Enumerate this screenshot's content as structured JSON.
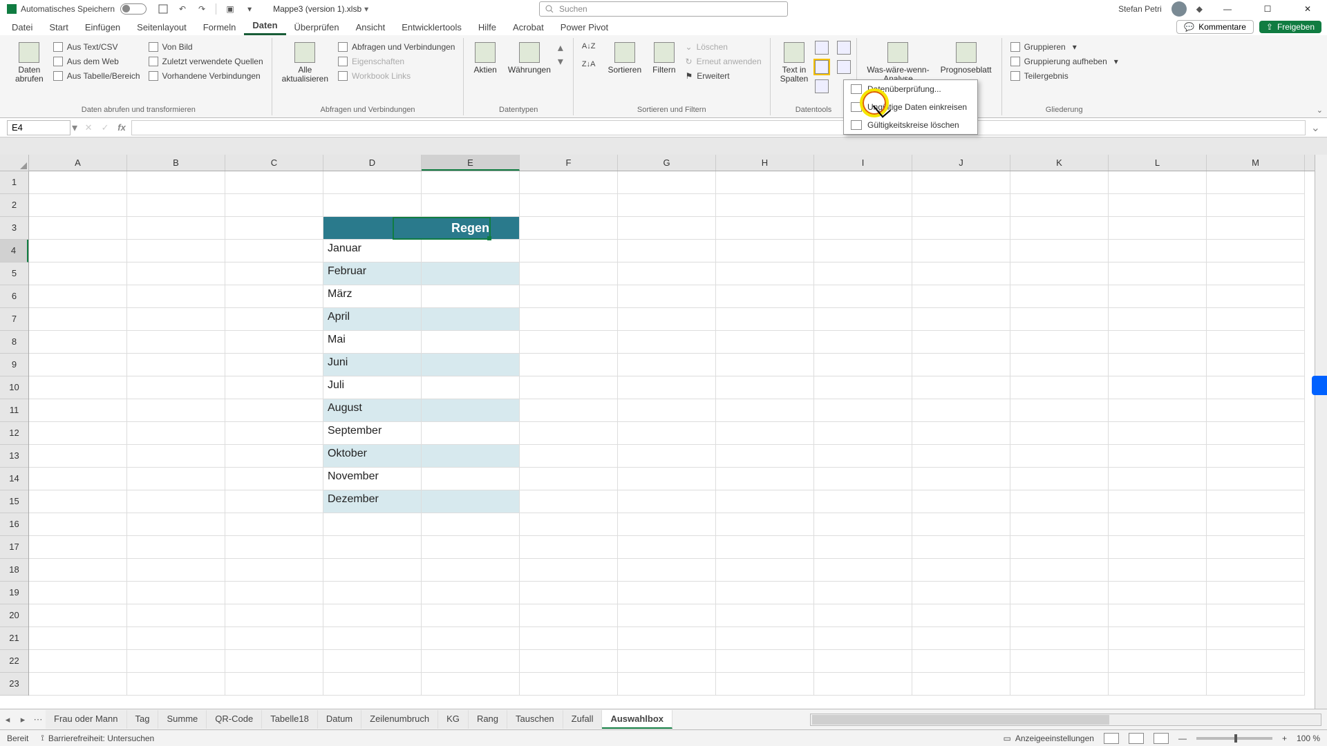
{
  "titlebar": {
    "autosave_label": "Automatisches Speichern",
    "filename": "Mappe3 (version 1).xlsb",
    "search_placeholder": "Suchen",
    "username": "Stefan Petri"
  },
  "tabs": {
    "items": [
      "Datei",
      "Start",
      "Einfügen",
      "Seitenlayout",
      "Formeln",
      "Daten",
      "Überprüfen",
      "Ansicht",
      "Entwicklertools",
      "Hilfe",
      "Acrobat",
      "Power Pivot"
    ],
    "active_index": 5,
    "comments": "Kommentare",
    "share": "Freigeben"
  },
  "ribbon": {
    "g0": {
      "btn": "Daten\nabrufen",
      "items": [
        "Aus Text/CSV",
        "Aus dem Web",
        "Zuletzt verwendete Quellen",
        "Aus Tabelle/Bereich",
        "Vorhandene Verbindungen",
        "Von Bild"
      ],
      "label": "Daten abrufen und transformieren"
    },
    "g1": {
      "btn": "Alle\naktualisieren",
      "items": [
        "Abfragen und Verbindungen",
        "Eigenschaften",
        "Workbook Links"
      ],
      "label": "Abfragen und Verbindungen"
    },
    "g2": {
      "btn1": "Aktien",
      "btn2": "Währungen",
      "label": "Datentypen"
    },
    "g3": {
      "sort": "Sortieren",
      "filter": "Filtern",
      "clear": "Löschen",
      "reapply": "Erneut anwenden",
      "adv": "Erweitert",
      "label": "Sortieren und Filtern"
    },
    "g4": {
      "btn": "Text in\nSpalten",
      "label": "Datentools"
    },
    "g5": {
      "btn1": "Was-wäre-wenn-\nAnalyse",
      "btn2": "Prognoseblatt"
    },
    "g6": {
      "items": [
        "Gruppieren",
        "Gruppierung aufheben",
        "Teilergebnis"
      ],
      "label": "Gliederung"
    }
  },
  "dropdown": {
    "i0": "Datenüberprüfung...",
    "i1": "Ungültige Daten einkreisen",
    "i2": "Gültigkeitskreise löschen"
  },
  "namebox": {
    "ref": "E4"
  },
  "columns": [
    "A",
    "B",
    "C",
    "D",
    "E",
    "F",
    "G",
    "H",
    "I",
    "J",
    "K",
    "L",
    "M"
  ],
  "rows": [
    "1",
    "2",
    "3",
    "4",
    "5",
    "6",
    "7",
    "8",
    "9",
    "10",
    "11",
    "12",
    "13",
    "14",
    "15",
    "16",
    "17",
    "18",
    "19",
    "20",
    "21",
    "22",
    "23"
  ],
  "table": {
    "header": "Regen",
    "months": [
      "Januar",
      "Februar",
      "März",
      "April",
      "Mai",
      "Juni",
      "Juli",
      "August",
      "September",
      "Oktober",
      "November",
      "Dezember"
    ]
  },
  "sheets": {
    "tabs": [
      "Frau oder Mann",
      "Tag",
      "Summe",
      "QR-Code",
      "Tabelle18",
      "Datum",
      "Zeilenumbruch",
      "KG",
      "Rang",
      "Tauschen",
      "Zufall",
      "Auswahlbox"
    ],
    "active_index": 11
  },
  "status": {
    "ready": "Bereit",
    "acc": "Barrierefreiheit: Untersuchen",
    "display": "Anzeigeeinstellungen",
    "zoom": "100 %"
  }
}
